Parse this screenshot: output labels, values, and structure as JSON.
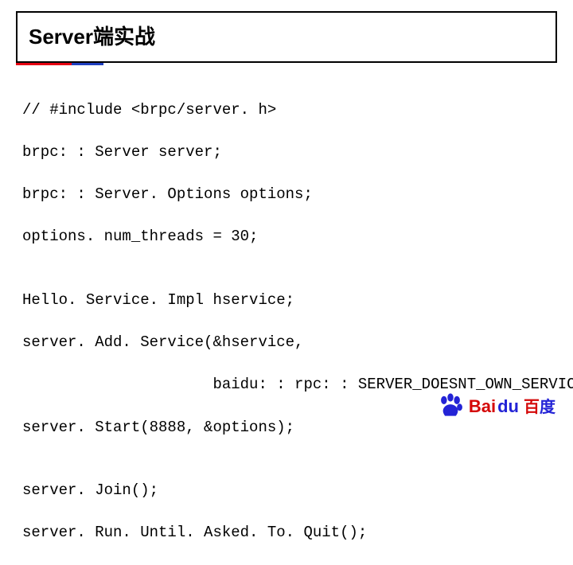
{
  "title": "Server端实战",
  "code": {
    "l1": "// #include <brpc/server. h>",
    "l2": "brpc: : Server server;",
    "l3": "brpc: : Server. Options options;",
    "l4": "options. num_threads = 30;",
    "l5": "Hello. Service. Impl hservice;",
    "l6": "server. Add. Service(&hservice,",
    "l7": "                     baidu: : rpc: : SERVER_DOESNT_OWN_SERVICE);",
    "l8": "server. Start(8888, &options);",
    "l9": "server. Join();",
    "l10": "server. Run. Until. Asked. To. Quit();"
  },
  "logo": {
    "bai": "Bai",
    "du": "du",
    "cn1": "百",
    "cn2": "度"
  }
}
